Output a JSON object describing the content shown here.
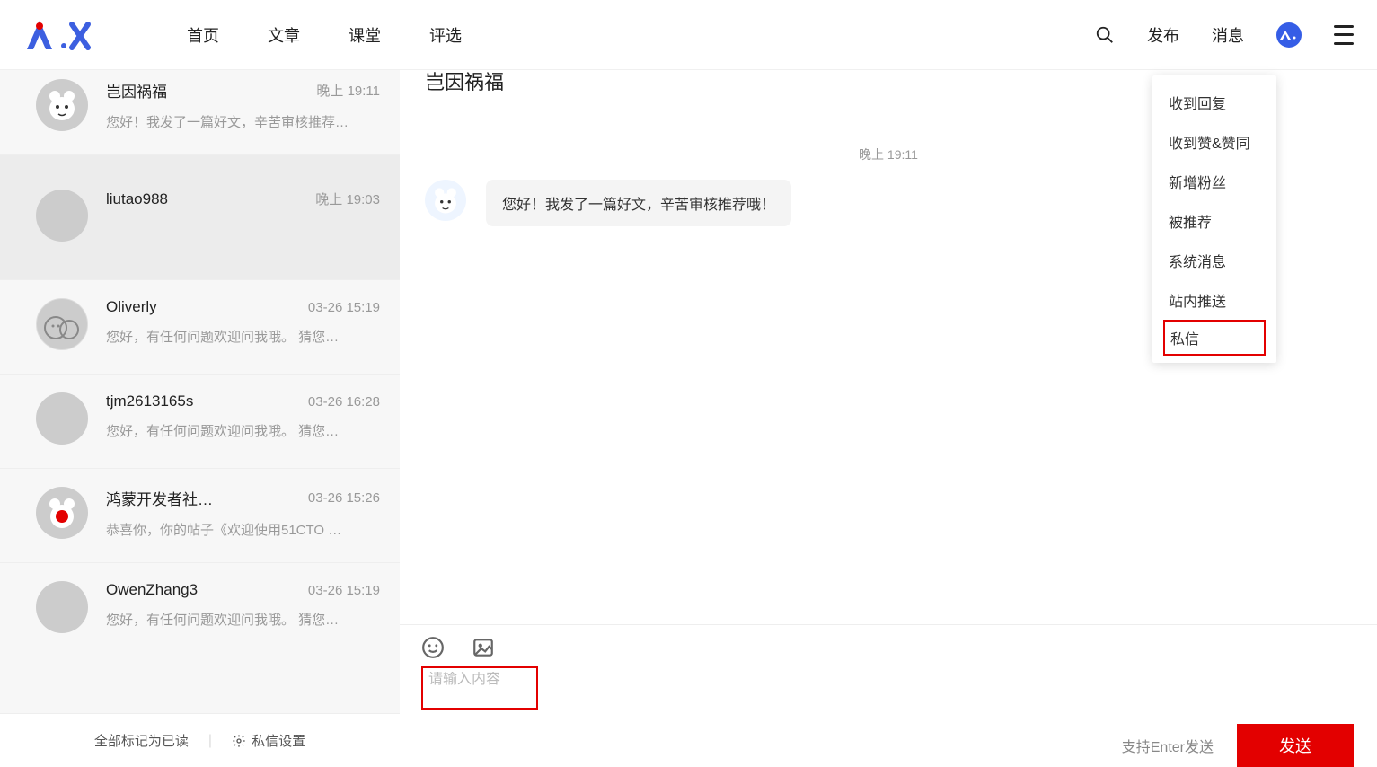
{
  "header": {
    "nav": [
      "首页",
      "文章",
      "课堂",
      "评选"
    ],
    "publish": "发布",
    "messages": "消息"
  },
  "dropdown": {
    "items": [
      "收到回复",
      "收到赞&赞同",
      "新增粉丝",
      "被推荐",
      "系统消息",
      "站内推送"
    ],
    "boxed": "私信"
  },
  "conversations": [
    {
      "name": "岂因祸福",
      "time": "晚上 19:11",
      "preview": "您好！我发了一篇好文，辛苦审核推荐…",
      "avatar": "bear"
    },
    {
      "name": "liutao988",
      "time": "晚上 19:03",
      "preview": "",
      "avatar": "photo1"
    },
    {
      "name": "Oliverly",
      "time": "03-26 15:19",
      "preview": "您好，有任何问题欢迎问我哦。 猜您…",
      "avatar": "oliver"
    },
    {
      "name": "tjm2613165s",
      "time": "03-26 16:28",
      "preview": "您好，有任何问题欢迎问我哦。 猜您…",
      "avatar": "tjm"
    },
    {
      "name": "鸿蒙开发者社…",
      "time": "03-26 15:26",
      "preview": "恭喜你，你的帖子《欢迎使用51CTO …",
      "avatar": "hm"
    },
    {
      "name": "OwenZhang3",
      "time": "03-26 15:19",
      "preview": "您好，有任何问题欢迎问我哦。 猜您…",
      "avatar": "owen"
    }
  ],
  "conv_footer": {
    "mark_all": "全部标记为已读",
    "settings": "私信设置"
  },
  "chat": {
    "title": "岂因祸福",
    "time": "晚上 19:11",
    "messages": [
      {
        "text": "您好！我发了一篇好文，辛苦审核推荐哦！"
      }
    ],
    "placeholder": "请输入内容",
    "hint": "支持Enter发送",
    "send": "发送"
  }
}
